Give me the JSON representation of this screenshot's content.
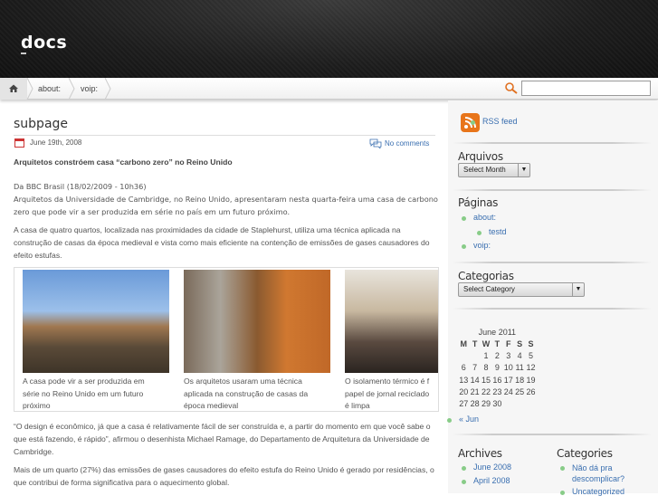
{
  "site": {
    "title": "docs"
  },
  "nav": {
    "home": "home",
    "crumbs": [
      "about:",
      "voip:"
    ],
    "search_placeholder": ""
  },
  "post": {
    "title": "subpage",
    "date": "June 19th, 2008",
    "comments": "No comments",
    "headline": "Arquitetos constróem casa “carbono zero” no Reino Unido",
    "source": "Da BBC Brasil (18/02/2009 - 10h36)",
    "p1": "Arquitetos da Universidade de Cambridge, no Reino Unido, apresentaram nesta quarta-feira uma casa de carbono zero que pode vir a ser produzida em série no país em um futuro próximo.",
    "p2": "A casa de quatro quartos, localizada nas proximidades da cidade de Staplehurst, utiliza uma técnica aplicada na construção de casas da época medieval e vista como mais eficiente na contenção de emissões de gases causadores do efeito estufas.",
    "gallery": [
      {
        "caption": [
          "A casa pode vir a ser produzida em",
          "série no Reino Unido em um futuro",
          "próximo"
        ]
      },
      {
        "caption": [
          "Os arquitetos usaram uma técnica",
          "aplicada na construção de casas da",
          "época medieval"
        ]
      },
      {
        "caption": [
          "O isolamento térmico é f",
          "papel de jornal reciclado",
          "é limpa"
        ]
      }
    ],
    "p3": "“O design é econômico, já que a casa é relativamente fácil de ser construída e, a partir do momento em que você sabe o que está fazendo, é rápido”, afirmou o desenhista Michael Ramage, do Departamento de Arquitetura da Universidade de Cambridge.",
    "p4": "Mais de um quarto (27%) das emissões de gases causadores do efeito estufa do Reino Unido é gerado por residências, o que contribui de forma significativa para o aquecimento global."
  },
  "sidebar": {
    "rss": "RSS feed",
    "arquivos": {
      "title": "Arquivos",
      "select": "Select Month"
    },
    "paginas": {
      "title": "Páginas",
      "items": [
        "about:",
        "testd",
        "voip:"
      ]
    },
    "categorias": {
      "title": "Categorias",
      "select": "Select Category"
    },
    "calendar": {
      "caption": "June 2011",
      "days": [
        "M",
        "T",
        "W",
        "T",
        "F",
        "S",
        "S"
      ],
      "weeks": [
        [
          "",
          "",
          "1",
          "2",
          "3",
          "4",
          "5"
        ],
        [
          "6",
          "7",
          "8",
          "9",
          "10",
          "11",
          "12"
        ],
        [
          "13",
          "14",
          "15",
          "16",
          "17",
          "18",
          "19"
        ],
        [
          "20",
          "21",
          "22",
          "23",
          "24",
          "25",
          "26"
        ],
        [
          "27",
          "28",
          "29",
          "30",
          "",
          "",
          ""
        ]
      ],
      "prev": "« Jun"
    },
    "archives": {
      "title": "Archives",
      "items": [
        "June 2008",
        "April 2008"
      ]
    },
    "categories": {
      "title": "Categories",
      "items": [
        "Não dá pra descomplicar?",
        "Uncategorized"
      ]
    }
  }
}
